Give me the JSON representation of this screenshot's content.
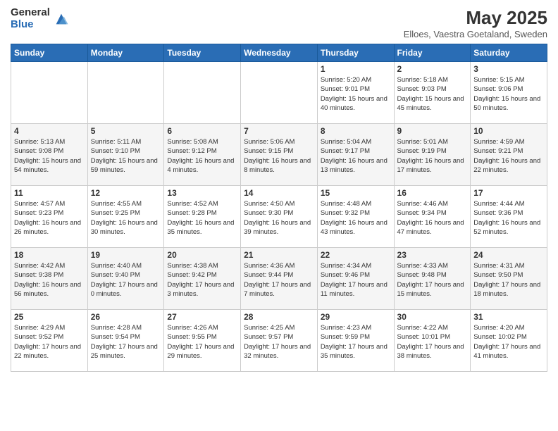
{
  "header": {
    "logo_general": "General",
    "logo_blue": "Blue",
    "month_title": "May 2025",
    "location": "Elloes, Vaestra Goetaland, Sweden"
  },
  "weekdays": [
    "Sunday",
    "Monday",
    "Tuesday",
    "Wednesday",
    "Thursday",
    "Friday",
    "Saturday"
  ],
  "weeks": [
    [
      {
        "day": "",
        "info": ""
      },
      {
        "day": "",
        "info": ""
      },
      {
        "day": "",
        "info": ""
      },
      {
        "day": "",
        "info": ""
      },
      {
        "day": "1",
        "info": "Sunrise: 5:20 AM\nSunset: 9:01 PM\nDaylight: 15 hours and 40 minutes."
      },
      {
        "day": "2",
        "info": "Sunrise: 5:18 AM\nSunset: 9:03 PM\nDaylight: 15 hours and 45 minutes."
      },
      {
        "day": "3",
        "info": "Sunrise: 5:15 AM\nSunset: 9:06 PM\nDaylight: 15 hours and 50 minutes."
      }
    ],
    [
      {
        "day": "4",
        "info": "Sunrise: 5:13 AM\nSunset: 9:08 PM\nDaylight: 15 hours and 54 minutes."
      },
      {
        "day": "5",
        "info": "Sunrise: 5:11 AM\nSunset: 9:10 PM\nDaylight: 15 hours and 59 minutes."
      },
      {
        "day": "6",
        "info": "Sunrise: 5:08 AM\nSunset: 9:12 PM\nDaylight: 16 hours and 4 minutes."
      },
      {
        "day": "7",
        "info": "Sunrise: 5:06 AM\nSunset: 9:15 PM\nDaylight: 16 hours and 8 minutes."
      },
      {
        "day": "8",
        "info": "Sunrise: 5:04 AM\nSunset: 9:17 PM\nDaylight: 16 hours and 13 minutes."
      },
      {
        "day": "9",
        "info": "Sunrise: 5:01 AM\nSunset: 9:19 PM\nDaylight: 16 hours and 17 minutes."
      },
      {
        "day": "10",
        "info": "Sunrise: 4:59 AM\nSunset: 9:21 PM\nDaylight: 16 hours and 22 minutes."
      }
    ],
    [
      {
        "day": "11",
        "info": "Sunrise: 4:57 AM\nSunset: 9:23 PM\nDaylight: 16 hours and 26 minutes."
      },
      {
        "day": "12",
        "info": "Sunrise: 4:55 AM\nSunset: 9:25 PM\nDaylight: 16 hours and 30 minutes."
      },
      {
        "day": "13",
        "info": "Sunrise: 4:52 AM\nSunset: 9:28 PM\nDaylight: 16 hours and 35 minutes."
      },
      {
        "day": "14",
        "info": "Sunrise: 4:50 AM\nSunset: 9:30 PM\nDaylight: 16 hours and 39 minutes."
      },
      {
        "day": "15",
        "info": "Sunrise: 4:48 AM\nSunset: 9:32 PM\nDaylight: 16 hours and 43 minutes."
      },
      {
        "day": "16",
        "info": "Sunrise: 4:46 AM\nSunset: 9:34 PM\nDaylight: 16 hours and 47 minutes."
      },
      {
        "day": "17",
        "info": "Sunrise: 4:44 AM\nSunset: 9:36 PM\nDaylight: 16 hours and 52 minutes."
      }
    ],
    [
      {
        "day": "18",
        "info": "Sunrise: 4:42 AM\nSunset: 9:38 PM\nDaylight: 16 hours and 56 minutes."
      },
      {
        "day": "19",
        "info": "Sunrise: 4:40 AM\nSunset: 9:40 PM\nDaylight: 17 hours and 0 minutes."
      },
      {
        "day": "20",
        "info": "Sunrise: 4:38 AM\nSunset: 9:42 PM\nDaylight: 17 hours and 3 minutes."
      },
      {
        "day": "21",
        "info": "Sunrise: 4:36 AM\nSunset: 9:44 PM\nDaylight: 17 hours and 7 minutes."
      },
      {
        "day": "22",
        "info": "Sunrise: 4:34 AM\nSunset: 9:46 PM\nDaylight: 17 hours and 11 minutes."
      },
      {
        "day": "23",
        "info": "Sunrise: 4:33 AM\nSunset: 9:48 PM\nDaylight: 17 hours and 15 minutes."
      },
      {
        "day": "24",
        "info": "Sunrise: 4:31 AM\nSunset: 9:50 PM\nDaylight: 17 hours and 18 minutes."
      }
    ],
    [
      {
        "day": "25",
        "info": "Sunrise: 4:29 AM\nSunset: 9:52 PM\nDaylight: 17 hours and 22 minutes."
      },
      {
        "day": "26",
        "info": "Sunrise: 4:28 AM\nSunset: 9:54 PM\nDaylight: 17 hours and 25 minutes."
      },
      {
        "day": "27",
        "info": "Sunrise: 4:26 AM\nSunset: 9:55 PM\nDaylight: 17 hours and 29 minutes."
      },
      {
        "day": "28",
        "info": "Sunrise: 4:25 AM\nSunset: 9:57 PM\nDaylight: 17 hours and 32 minutes."
      },
      {
        "day": "29",
        "info": "Sunrise: 4:23 AM\nSunset: 9:59 PM\nDaylight: 17 hours and 35 minutes."
      },
      {
        "day": "30",
        "info": "Sunrise: 4:22 AM\nSunset: 10:01 PM\nDaylight: 17 hours and 38 minutes."
      },
      {
        "day": "31",
        "info": "Sunrise: 4:20 AM\nSunset: 10:02 PM\nDaylight: 17 hours and 41 minutes."
      }
    ]
  ]
}
